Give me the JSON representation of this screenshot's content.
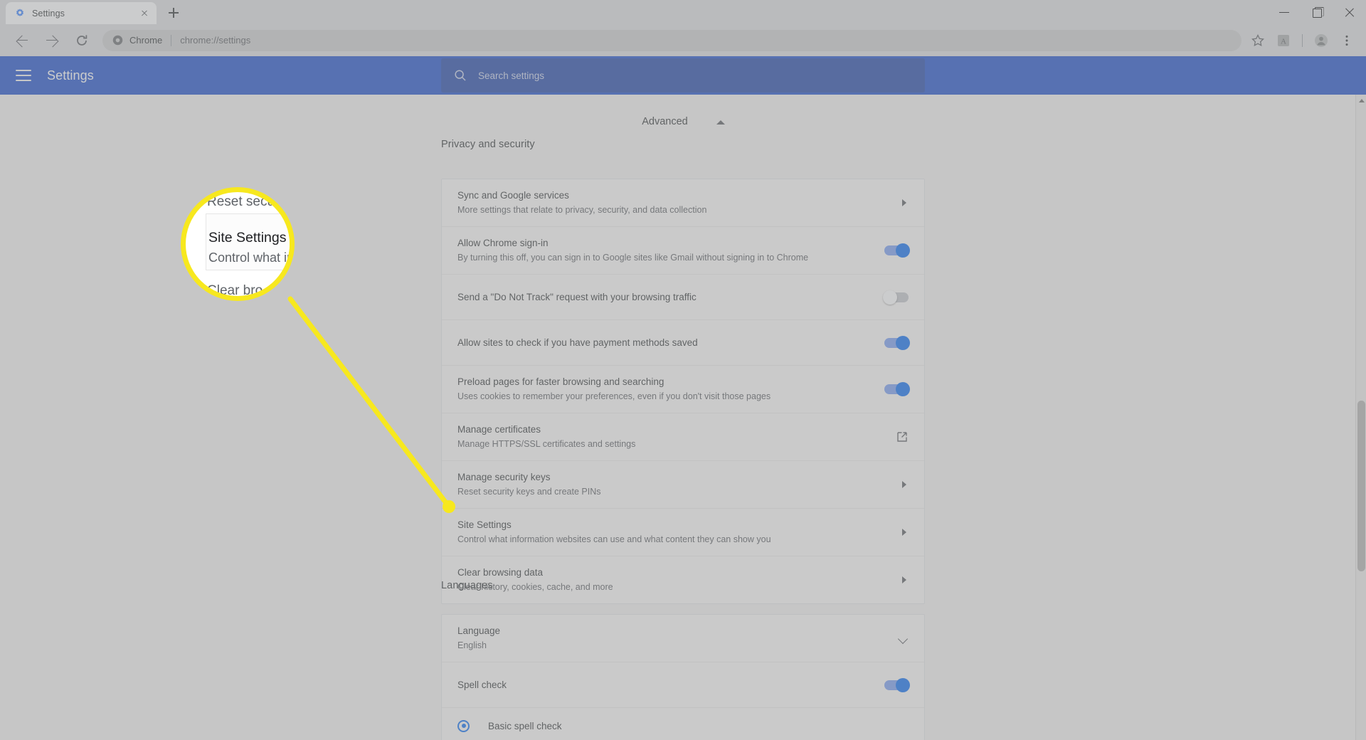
{
  "window": {
    "controls": [
      {
        "name": "minimize",
        "label": "Minimize"
      },
      {
        "name": "maximize",
        "label": "Restore"
      },
      {
        "name": "close",
        "label": "Close"
      }
    ]
  },
  "tab": {
    "title": "Settings",
    "favicon": "chrome-settings-gear-icon",
    "close_label": "Close tab",
    "newtab_label": "New tab"
  },
  "toolbar": {
    "back_label": "Back",
    "forward_label": "Forward",
    "reload_label": "Reload",
    "omnibox": {
      "chip_label": "Chrome",
      "url": "chrome://settings",
      "icon": "chrome-logo-icon"
    },
    "bookmark_label": "Bookmark this tab",
    "extension_label": "Adobe Acrobat extension",
    "profile_label": "Profile",
    "menu_label": "Customize and control Google Chrome"
  },
  "settings_header": {
    "menu_label": "Main menu",
    "title": "Settings"
  },
  "search": {
    "placeholder": "Search settings",
    "icon": "search-icon"
  },
  "advanced": {
    "label": "Advanced",
    "state": "expanded"
  },
  "sections": [
    {
      "id": "privacy",
      "heading": "Privacy and security",
      "rows": [
        {
          "title": "Sync and Google services",
          "sub": "More settings that relate to privacy, security, and data collection",
          "control": "chevron-right"
        },
        {
          "title": "Allow Chrome sign-in",
          "sub": "By turning this off, you can sign in to Google sites like Gmail without signing in to Chrome",
          "control": "toggle",
          "toggle_state": "on"
        },
        {
          "title": "Send a \"Do Not Track\" request with your browsing traffic",
          "sub": "",
          "control": "toggle",
          "toggle_state": "off"
        },
        {
          "title": "Allow sites to check if you have payment methods saved",
          "sub": "",
          "control": "toggle",
          "toggle_state": "on"
        },
        {
          "title": "Preload pages for faster browsing and searching",
          "sub": "Uses cookies to remember your preferences, even if you don't visit those pages",
          "control": "toggle",
          "toggle_state": "on"
        },
        {
          "title": "Manage certificates",
          "sub": "Manage HTTPS/SSL certificates and settings",
          "control": "external-link"
        },
        {
          "title": "Manage security keys",
          "sub": "Reset security keys and create PINs",
          "control": "chevron-right"
        },
        {
          "title": "Site Settings",
          "sub": "Control what information websites can use and what content they can show you",
          "control": "chevron-right",
          "highlighted": true
        },
        {
          "title": "Clear browsing data",
          "sub": "Clear history, cookies, cache, and more",
          "control": "chevron-right"
        }
      ]
    },
    {
      "id": "languages",
      "heading": "Languages",
      "rows": [
        {
          "title": "Language",
          "sub": "English",
          "control": "chevron-down"
        },
        {
          "title": "Spell check",
          "sub": "",
          "control": "toggle",
          "toggle_state": "on"
        }
      ],
      "radio": {
        "label": "Basic spell check",
        "selected": true
      }
    }
  ],
  "callout": {
    "magnified_lines": {
      "line1": "Reset secur",
      "line2": "Site Settings",
      "line3": "Control what inf",
      "line4": "Clear bro"
    },
    "ring_color": "#f7e81e",
    "target": "Site Settings"
  },
  "colors": {
    "header_blue": "#2a56c6",
    "search_blue": "#2b4ea8",
    "toggle_on": "#1a73e8",
    "toggle_track_on": "#7b9ee8",
    "toggle_off": "#bdc1c6",
    "highlight_yellow": "#f7e81e",
    "page_bg": "#e8e8e8",
    "card_bg": "#f0f0f0"
  },
  "scrollbar": {
    "position": "right",
    "visible": true
  }
}
